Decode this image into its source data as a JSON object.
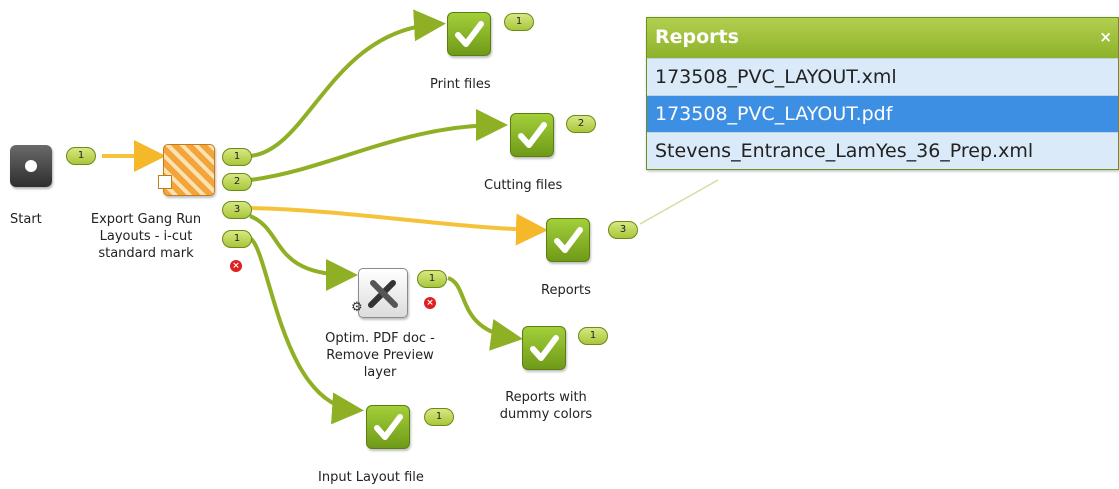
{
  "nodes": {
    "start": {
      "label": "Start"
    },
    "export": {
      "label_lines": [
        "Export Gang Run",
        "Layouts -  i-cut",
        "standard mark"
      ],
      "error_icon": "error-icon"
    },
    "optim": {
      "label_lines": [
        "Optim. PDF doc -",
        "Remove Preview",
        "layer"
      ],
      "error_icon": "error-icon"
    },
    "print_files": {
      "label": "Print files",
      "count": "1"
    },
    "cutting_files": {
      "label": "Cutting files",
      "count": "2"
    },
    "reports": {
      "label": "Reports",
      "count": "3"
    },
    "reports_dummy": {
      "label_lines": [
        "Reports with",
        "dummy colors"
      ],
      "count": "1"
    },
    "input_layout": {
      "label": "Input Layout file",
      "count": "1"
    }
  },
  "connections": {
    "start_out": "1",
    "export_out1": "1",
    "export_out2": "2",
    "export_out3": "3",
    "export_out4": "1",
    "optim_out": "1"
  },
  "reports_panel": {
    "title": "Reports",
    "close": "×",
    "files": [
      "173508_PVC_LAYOUT.xml",
      "173508_PVC_LAYOUT.pdf",
      "Stevens_Entrance_LamYes_36_Prep.xml"
    ],
    "selected_index": 1
  },
  "colors": {
    "connector": "#8fb025",
    "highlight_connector": "#f5c23a",
    "check_green": "#8bb82a",
    "selected_row": "#3d8fe3",
    "row_bg": "#dbeaf8"
  }
}
